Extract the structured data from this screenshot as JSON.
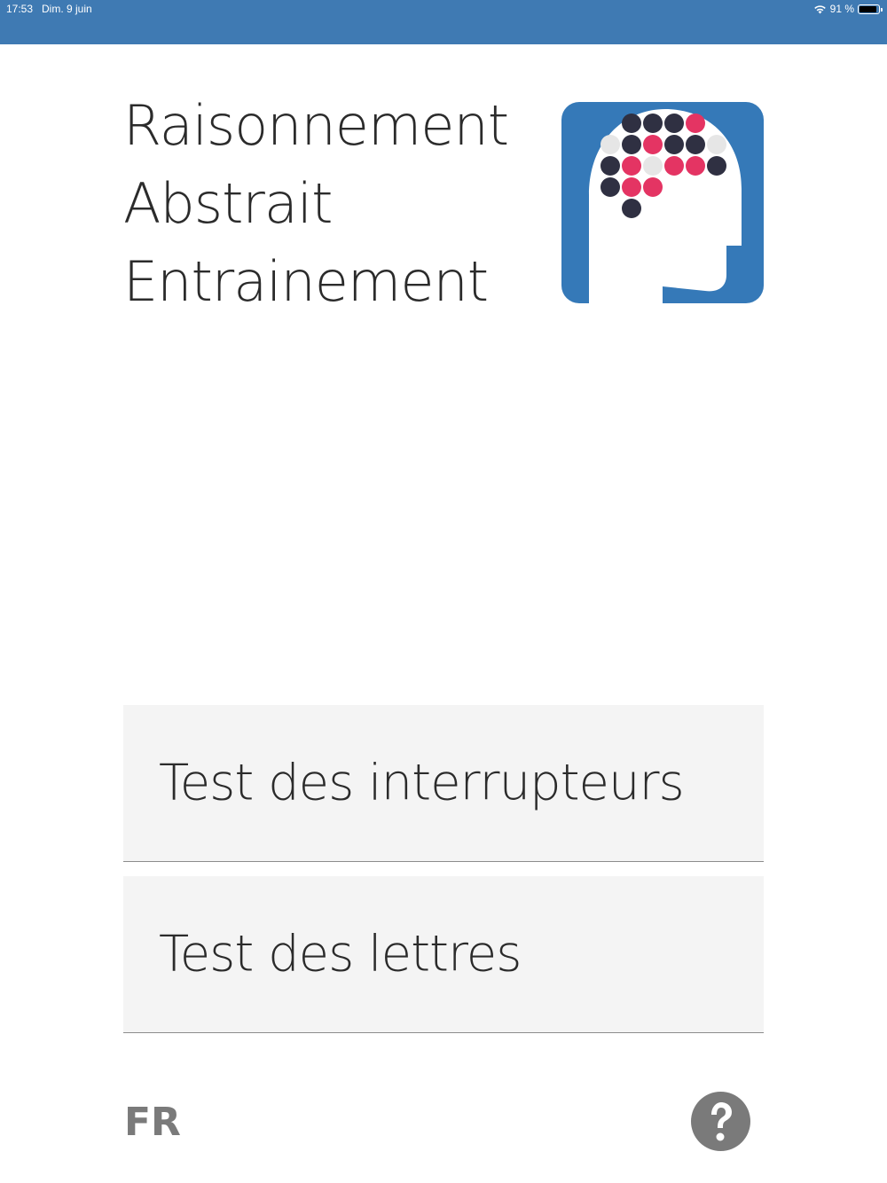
{
  "status_bar": {
    "time": "17:53",
    "date": "Dim. 9 juin",
    "battery_text": "91 %",
    "battery_level": 0.91,
    "icons": [
      "wifi-icon",
      "battery-icon"
    ]
  },
  "header": {
    "title_lines": [
      "Raisonnement",
      "Abstrait",
      "Entrainement"
    ],
    "logo_icon": "head-dots-logo-icon"
  },
  "menu": {
    "items": [
      {
        "label": "Test des interrupteurs"
      },
      {
        "label": "Test des lettres"
      }
    ]
  },
  "footer": {
    "language": "FR",
    "help_icon": "question-mark-icon"
  },
  "colors": {
    "status_bar": "#3f7ab3",
    "logo_background": "#3579b8",
    "dot_dark": "#2f3042",
    "dot_pink": "#e43463",
    "dot_light": "#e6e6e6",
    "button_background": "#f4f4f4",
    "footer_gray": "#7a7a7a"
  }
}
